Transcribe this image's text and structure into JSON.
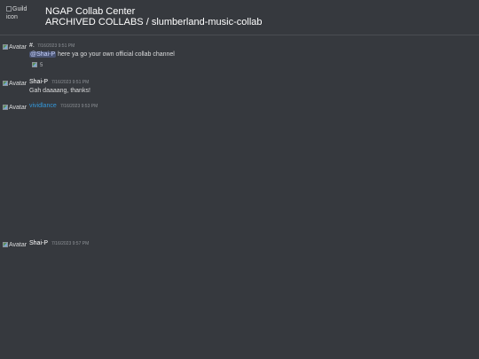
{
  "header": {
    "guild_icon_alt": "Guild icon",
    "guild_name": "NGAP Collab Center",
    "channel_path": "ARCHIVED COLLABS / slumberland-music-collab"
  },
  "messages": [
    {
      "avatar_alt": "Avatar",
      "author": "#.",
      "timestamp": "7/16/2023 9:51 PM",
      "mention": "@Shai-P",
      "text": " here ya go your own official collab channel",
      "reaction_count": "5"
    },
    {
      "avatar_alt": "Avatar",
      "author": "Shai-P",
      "timestamp": "7/16/2023 9:51 PM",
      "text": "Gah daaaang, thanks!"
    },
    {
      "avatar_alt": "Avatar",
      "author": "vividlance",
      "timestamp": "7/16/2023 9:53 PM",
      "author_color": "#3498db"
    },
    {
      "avatar_alt": "Avatar",
      "author": "Shai-P",
      "timestamp": "7/16/2023 9:57 PM"
    }
  ]
}
